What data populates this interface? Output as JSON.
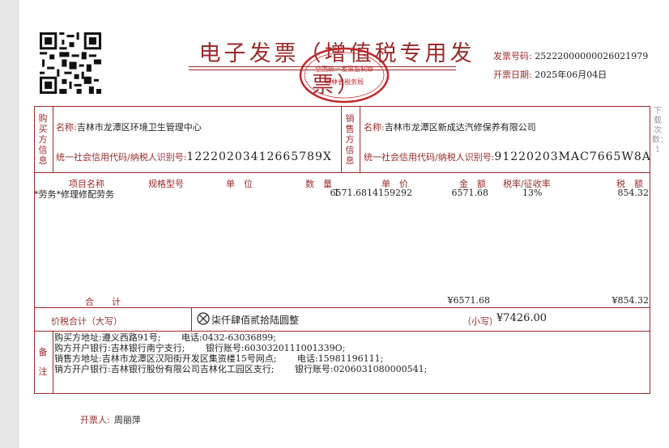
{
  "invoice": {
    "title": "电子发票（增值税专用发票）",
    "number_label": "发票号码:",
    "number": "25222000000026021979",
    "date_label": "开票日期:",
    "date": "2025年06月04日",
    "seal_text": "国家税务总局 吉林省税务局",
    "side_note": "下载次数：1"
  },
  "buyer": {
    "section_label": "购买方信息",
    "name_label": "名称:",
    "name": "吉林市龙潭区环境卫生管理中心",
    "tax_label": "统一社会信用代码/纳税人识别号:",
    "tax_id": "12220203412665789X"
  },
  "seller": {
    "section_label": "销售方信息",
    "name_label": "名称:",
    "name": "吉林市龙潭区新成达汽修保养有限公司",
    "tax_label": "统一社会信用代码/纳税人识别号:",
    "tax_id": "91220203MAC7665W8A"
  },
  "items_table": {
    "headers": {
      "item_name": "项目名称",
      "spec": "规格型号",
      "unit": "单　位",
      "quantity": "数　量",
      "price": "单　价",
      "amount": "金　额",
      "tax_rate": "税率/征收率",
      "tax": "税　额"
    },
    "rows": [
      {
        "item_name": "*劳务*修理修配劳务",
        "spec": "",
        "unit": "",
        "quantity": "1",
        "price": "6571.6814159292",
        "amount": "6571.68",
        "tax_rate": "13%",
        "tax": "854.32"
      }
    ],
    "total_label": "合　　计",
    "total_amount": "¥6571.68",
    "total_tax": "¥854.32"
  },
  "grand_total": {
    "label": "价税合计（大写）",
    "uppercase": "柒仟肆佰贰拾陆圆整",
    "small_label": "（小写）",
    "small_value": "¥7426.00"
  },
  "remarks": {
    "label": "备注",
    "lines": [
      "购买方地址:遵义西路91号;　　 电话:0432-63036899;",
      "购方开户银行:吉林银行南宁支行;　　 银行账号:6030320111001339O;",
      "销售方地址:吉林市龙潭区汉阳街开发区集资楼15号网点;　　 电话:15981196111;",
      "销方开户银行:吉林银行股份有限公司吉林化工园区支行;　　 银行账号:0206031080000541;"
    ]
  },
  "issuer": {
    "label": "开票人:",
    "name": "周丽萍"
  },
  "colors": {
    "frame": "#9b2a2a",
    "text": "#222222",
    "background": "#e7e7e7"
  }
}
